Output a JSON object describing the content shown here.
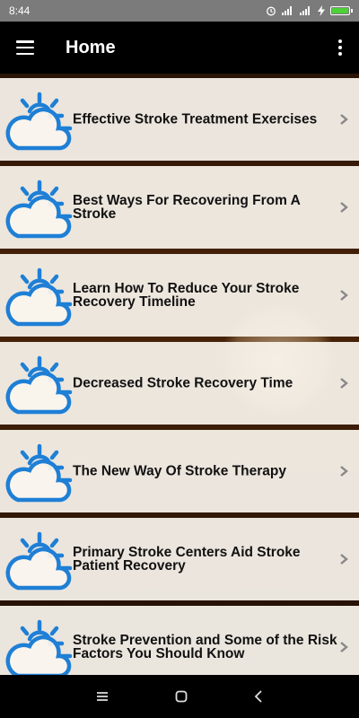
{
  "status_bar": {
    "time": "8:44"
  },
  "app_bar": {
    "title": "Home"
  },
  "items": [
    {
      "label": "Effective Stroke Treatment Exercises"
    },
    {
      "label": "Best Ways For Recovering From A Stroke"
    },
    {
      "label": "Learn How To Reduce Your Stroke Recovery Timeline"
    },
    {
      "label": "Decreased Stroke Recovery Time"
    },
    {
      "label": "The New Way Of Stroke Therapy"
    },
    {
      "label": "Primary Stroke Centers Aid Stroke Patient Recovery"
    },
    {
      "label": "Stroke Prevention and Some of the Risk Factors You Should Know"
    }
  ],
  "colors": {
    "icon_blue": "#1e7fd6",
    "app_bar": "#000000",
    "status_bar": "#7b7b7b"
  }
}
